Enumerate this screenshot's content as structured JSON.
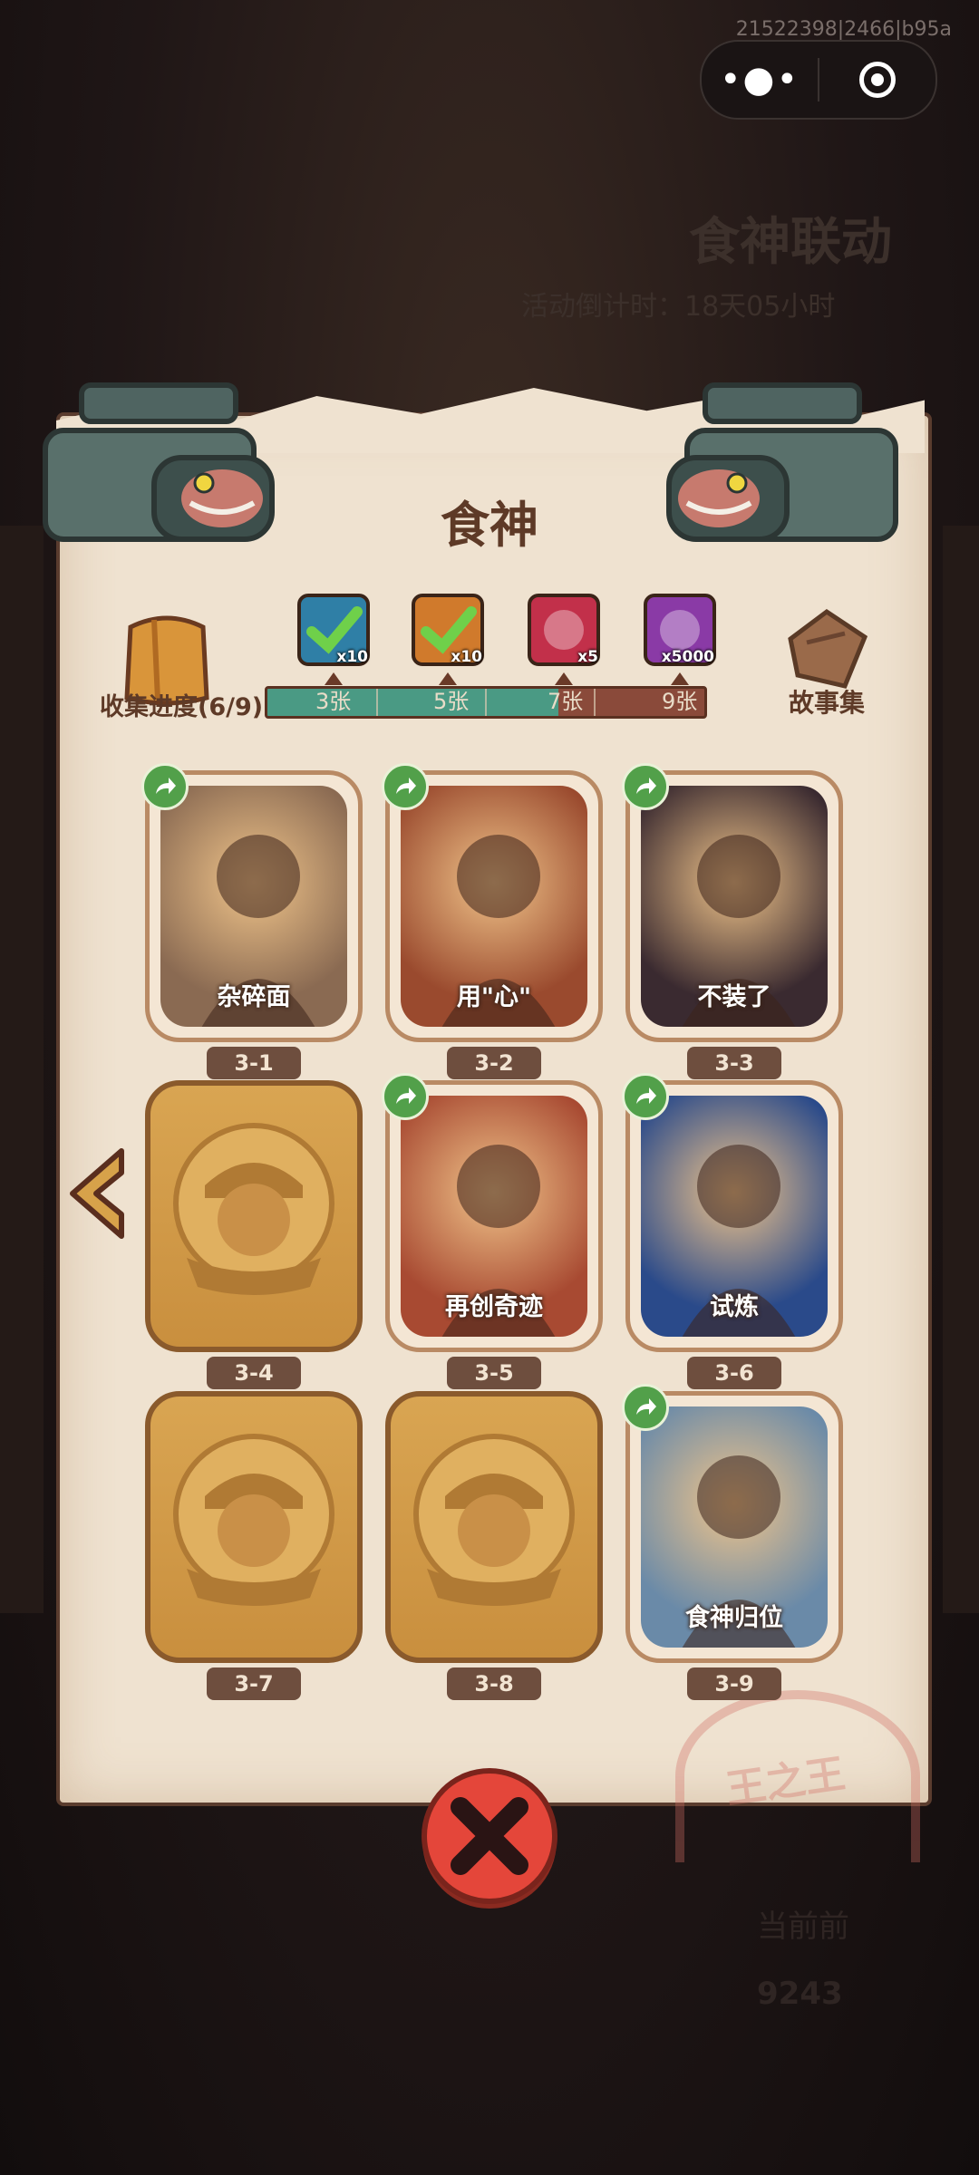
{
  "topbar": {
    "session_id": "21522398|2466|b95a",
    "menu_icon": "more-dots-icon",
    "close_icon": "target-icon"
  },
  "background": {
    "event_title": "食神联动",
    "countdown": "活动倒计时：18天05小时",
    "bottom_label": "当前前",
    "bottom_number": "9243"
  },
  "panel": {
    "title": "食神",
    "progress_label": "收集进度(6/9)",
    "story_label": "故事集",
    "seal_text": "王之王",
    "collected": 6,
    "total": 9,
    "progress_fraction": 0.667
  },
  "rewards": [
    {
      "threshold": "3张",
      "qty": "x10",
      "icon": "card-pack-green-icon",
      "claimed": true,
      "color": "#2f7fa6"
    },
    {
      "threshold": "5张",
      "qty": "x10",
      "icon": "card-pack-orange-icon",
      "claimed": true,
      "color": "#d07a2c"
    },
    {
      "threshold": "7张",
      "qty": "x5",
      "icon": "magic-disc-icon",
      "claimed": false,
      "color": "#c2304a"
    },
    {
      "threshold": "9张",
      "qty": "x5000",
      "icon": "crystal-icon",
      "claimed": false,
      "color": "#8a3aa6"
    }
  ],
  "cards": [
    {
      "id": "3-1",
      "title": "杂碎面",
      "unlocked": true,
      "bg": "#8a6a52"
    },
    {
      "id": "3-2",
      "title": "用\"心\"",
      "unlocked": true,
      "bg": "#9a4a2e"
    },
    {
      "id": "3-3",
      "title": "不装了",
      "unlocked": true,
      "bg": "#3a2a30"
    },
    {
      "id": "3-4",
      "title": "",
      "unlocked": false,
      "bg": ""
    },
    {
      "id": "3-5",
      "title": "再创奇迹",
      "unlocked": true,
      "bg": "#a84a32"
    },
    {
      "id": "3-6",
      "title": "试炼",
      "unlocked": true,
      "bg": "#2a4a8a"
    },
    {
      "id": "3-7",
      "title": "",
      "unlocked": false,
      "bg": ""
    },
    {
      "id": "3-8",
      "title": "",
      "unlocked": false,
      "bg": ""
    },
    {
      "id": "3-9",
      "title": "食神归位",
      "unlocked": true,
      "bg": "#6a8aa8"
    }
  ],
  "icons": {
    "share": "share-icon",
    "prev": "chevron-left-icon",
    "close": "close-icon"
  }
}
